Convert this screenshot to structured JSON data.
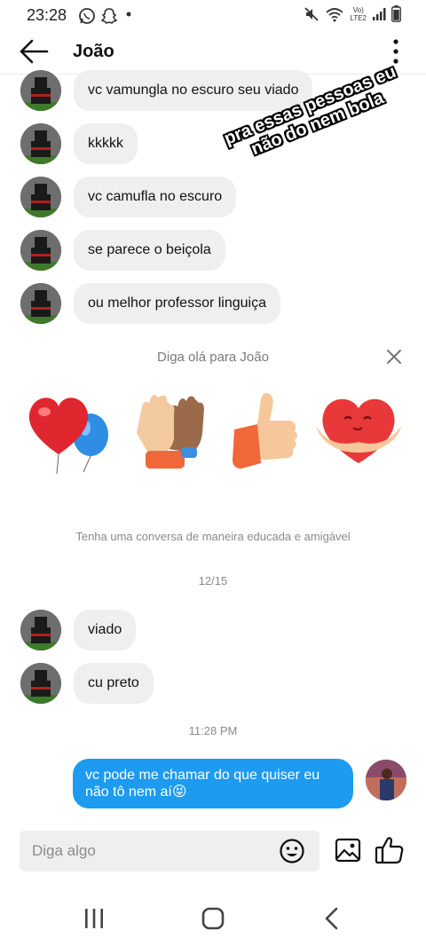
{
  "status_bar": {
    "time": "23:28",
    "network_label_top": "Vo)",
    "network_label_bottom": "LTE2",
    "icons": [
      "whatsapp-icon",
      "snapchat-icon",
      "dot-icon",
      "mute-icon",
      "wifi-icon",
      "signal-icon",
      "battery-icon"
    ]
  },
  "header": {
    "contact_name": "João"
  },
  "messages_top": [
    {
      "text": "vc vamungla no escuro seu viado"
    },
    {
      "text": "kkkkk"
    },
    {
      "text": "vc camufla no escuro"
    },
    {
      "text": "se parece o beiçola"
    },
    {
      "text": "ou melhor professor linguiça"
    }
  ],
  "overlay": {
    "line1": "pra essas pessoas eu",
    "line2": "não do nem bola"
  },
  "greeting": {
    "title": "Diga olá para João",
    "stickers": [
      "heart-balloons-sticker",
      "clapping-hands-sticker",
      "thumbs-up-sticker",
      "heart-hug-sticker"
    ],
    "note": "Tenha uma conversa de maneira educada e amigável"
  },
  "date_label": "12/15",
  "messages_bottom": [
    {
      "text": "viado"
    },
    {
      "text": "cu preto"
    }
  ],
  "time_label": "11:28 PM",
  "outgoing": {
    "line1": "vc pode me chamar do que quiser eu",
    "line2": "não tô nem aí😝"
  },
  "composer": {
    "placeholder": "Diga algo"
  },
  "colors": {
    "outgoing_bubble": "#1c9bf0",
    "incoming_bubble": "#efefef"
  }
}
